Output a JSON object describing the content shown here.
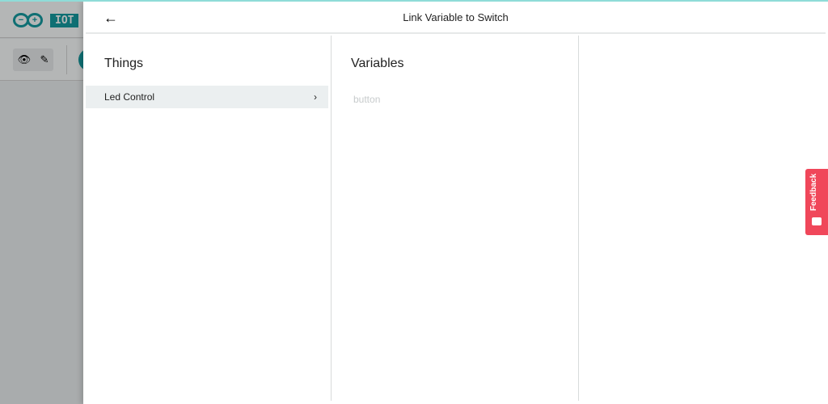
{
  "app": {
    "logo_text": "IOT"
  },
  "dialog": {
    "title": "Link Variable to Switch",
    "back_icon": "arrow-left-icon"
  },
  "things": {
    "heading": "Things",
    "items": [
      {
        "label": "Led Control"
      }
    ]
  },
  "variables": {
    "heading": "Variables",
    "items": [
      {
        "label": "button"
      }
    ]
  },
  "feedback": {
    "label": "Feedback",
    "color": "#f0475a"
  }
}
